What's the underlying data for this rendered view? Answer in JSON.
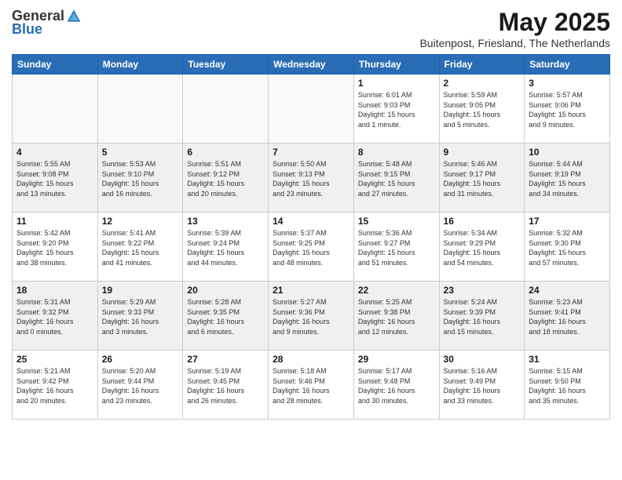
{
  "logo": {
    "general": "General",
    "blue": "Blue"
  },
  "title": "May 2025",
  "location": "Buitenpost, Friesland, The Netherlands",
  "days_of_week": [
    "Sunday",
    "Monday",
    "Tuesday",
    "Wednesday",
    "Thursday",
    "Friday",
    "Saturday"
  ],
  "weeks": [
    [
      {
        "day": "",
        "info": ""
      },
      {
        "day": "",
        "info": ""
      },
      {
        "day": "",
        "info": ""
      },
      {
        "day": "",
        "info": ""
      },
      {
        "day": "1",
        "info": "Sunrise: 6:01 AM\nSunset: 9:03 PM\nDaylight: 15 hours\nand 1 minute."
      },
      {
        "day": "2",
        "info": "Sunrise: 5:59 AM\nSunset: 9:05 PM\nDaylight: 15 hours\nand 5 minutes."
      },
      {
        "day": "3",
        "info": "Sunrise: 5:57 AM\nSunset: 9:06 PM\nDaylight: 15 hours\nand 9 minutes."
      }
    ],
    [
      {
        "day": "4",
        "info": "Sunrise: 5:55 AM\nSunset: 9:08 PM\nDaylight: 15 hours\nand 13 minutes."
      },
      {
        "day": "5",
        "info": "Sunrise: 5:53 AM\nSunset: 9:10 PM\nDaylight: 15 hours\nand 16 minutes."
      },
      {
        "day": "6",
        "info": "Sunrise: 5:51 AM\nSunset: 9:12 PM\nDaylight: 15 hours\nand 20 minutes."
      },
      {
        "day": "7",
        "info": "Sunrise: 5:50 AM\nSunset: 9:13 PM\nDaylight: 15 hours\nand 23 minutes."
      },
      {
        "day": "8",
        "info": "Sunrise: 5:48 AM\nSunset: 9:15 PM\nDaylight: 15 hours\nand 27 minutes."
      },
      {
        "day": "9",
        "info": "Sunrise: 5:46 AM\nSunset: 9:17 PM\nDaylight: 15 hours\nand 31 minutes."
      },
      {
        "day": "10",
        "info": "Sunrise: 5:44 AM\nSunset: 9:19 PM\nDaylight: 15 hours\nand 34 minutes."
      }
    ],
    [
      {
        "day": "11",
        "info": "Sunrise: 5:42 AM\nSunset: 9:20 PM\nDaylight: 15 hours\nand 38 minutes."
      },
      {
        "day": "12",
        "info": "Sunrise: 5:41 AM\nSunset: 9:22 PM\nDaylight: 15 hours\nand 41 minutes."
      },
      {
        "day": "13",
        "info": "Sunrise: 5:39 AM\nSunset: 9:24 PM\nDaylight: 15 hours\nand 44 minutes."
      },
      {
        "day": "14",
        "info": "Sunrise: 5:37 AM\nSunset: 9:25 PM\nDaylight: 15 hours\nand 48 minutes."
      },
      {
        "day": "15",
        "info": "Sunrise: 5:36 AM\nSunset: 9:27 PM\nDaylight: 15 hours\nand 51 minutes."
      },
      {
        "day": "16",
        "info": "Sunrise: 5:34 AM\nSunset: 9:29 PM\nDaylight: 15 hours\nand 54 minutes."
      },
      {
        "day": "17",
        "info": "Sunrise: 5:32 AM\nSunset: 9:30 PM\nDaylight: 15 hours\nand 57 minutes."
      }
    ],
    [
      {
        "day": "18",
        "info": "Sunrise: 5:31 AM\nSunset: 9:32 PM\nDaylight: 16 hours\nand 0 minutes."
      },
      {
        "day": "19",
        "info": "Sunrise: 5:29 AM\nSunset: 9:33 PM\nDaylight: 16 hours\nand 3 minutes."
      },
      {
        "day": "20",
        "info": "Sunrise: 5:28 AM\nSunset: 9:35 PM\nDaylight: 16 hours\nand 6 minutes."
      },
      {
        "day": "21",
        "info": "Sunrise: 5:27 AM\nSunset: 9:36 PM\nDaylight: 16 hours\nand 9 minutes."
      },
      {
        "day": "22",
        "info": "Sunrise: 5:25 AM\nSunset: 9:38 PM\nDaylight: 16 hours\nand 12 minutes."
      },
      {
        "day": "23",
        "info": "Sunrise: 5:24 AM\nSunset: 9:39 PM\nDaylight: 16 hours\nand 15 minutes."
      },
      {
        "day": "24",
        "info": "Sunrise: 5:23 AM\nSunset: 9:41 PM\nDaylight: 16 hours\nand 18 minutes."
      }
    ],
    [
      {
        "day": "25",
        "info": "Sunrise: 5:21 AM\nSunset: 9:42 PM\nDaylight: 16 hours\nand 20 minutes."
      },
      {
        "day": "26",
        "info": "Sunrise: 5:20 AM\nSunset: 9:44 PM\nDaylight: 16 hours\nand 23 minutes."
      },
      {
        "day": "27",
        "info": "Sunrise: 5:19 AM\nSunset: 9:45 PM\nDaylight: 16 hours\nand 26 minutes."
      },
      {
        "day": "28",
        "info": "Sunrise: 5:18 AM\nSunset: 9:46 PM\nDaylight: 16 hours\nand 28 minutes."
      },
      {
        "day": "29",
        "info": "Sunrise: 5:17 AM\nSunset: 9:48 PM\nDaylight: 16 hours\nand 30 minutes."
      },
      {
        "day": "30",
        "info": "Sunrise: 5:16 AM\nSunset: 9:49 PM\nDaylight: 16 hours\nand 33 minutes."
      },
      {
        "day": "31",
        "info": "Sunrise: 5:15 AM\nSunset: 9:50 PM\nDaylight: 16 hours\nand 35 minutes."
      }
    ]
  ]
}
